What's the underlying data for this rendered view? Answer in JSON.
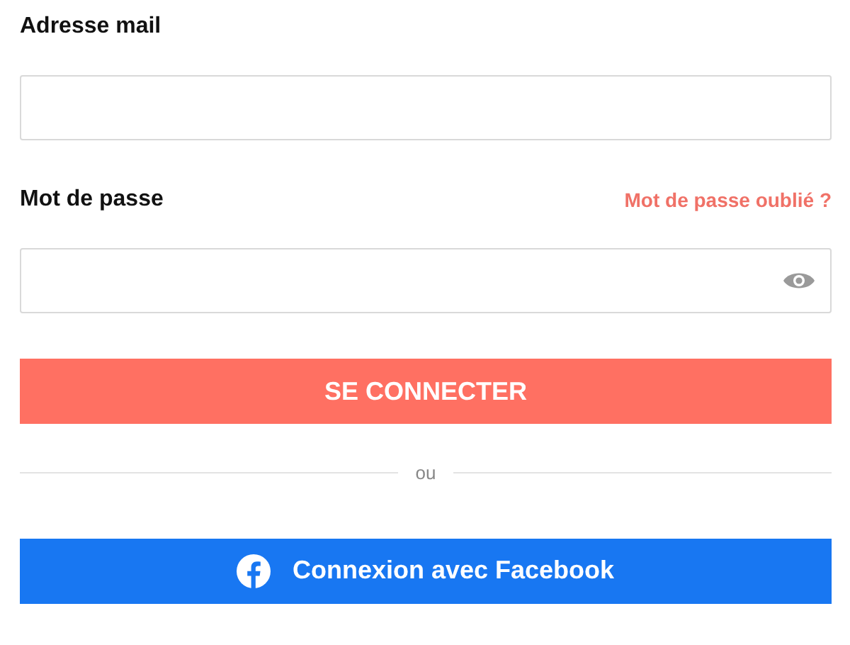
{
  "email": {
    "label": "Adresse mail"
  },
  "password": {
    "label": "Mot de passe",
    "forgot_link": "Mot de passe oublié ?"
  },
  "submit_button": "SE CONNECTER",
  "separator": "ou",
  "facebook_button": "Connexion avec Facebook"
}
